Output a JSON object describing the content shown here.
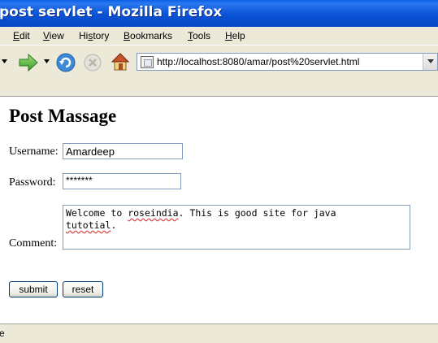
{
  "window": {
    "title": "post servlet - Mozilla Firefox"
  },
  "menu": {
    "items": [
      {
        "label": "Edit",
        "accel": "E"
      },
      {
        "label": "View",
        "accel": "V"
      },
      {
        "label": "History",
        "accel": "s"
      },
      {
        "label": "Bookmarks",
        "accel": "B"
      },
      {
        "label": "Tools",
        "accel": "T"
      },
      {
        "label": "Help",
        "accel": "H"
      }
    ]
  },
  "toolbar": {
    "url": "http://localhost:8080/amar/post%20servlet.html",
    "icons": [
      "back-dropdown-icon",
      "forward-icon",
      "forward-dropdown-icon",
      "reload-icon",
      "stop-icon",
      "home-icon",
      "page-icon",
      "url-dropdown-icon"
    ]
  },
  "page": {
    "title": "Post Massage",
    "username_label": "Username:",
    "username_value": "Amardeep",
    "password_label": "Password:",
    "password_mask": "*******",
    "comment_label": "Comment:",
    "comment_words": [
      "Welcome",
      "to",
      "roseindia.",
      "This",
      "is",
      "good",
      "site",
      "for",
      "java",
      "tutotial."
    ],
    "comment_misspelled": [
      "roseindia",
      "tutotial"
    ],
    "submit_label": "submit",
    "reset_label": "reset"
  },
  "status": {
    "text": "e"
  },
  "colors": {
    "titlebar": "#0a52d6",
    "chrome": "#ece9d8",
    "field_border": "#7f9db9",
    "button_border": "#003c74",
    "spellcheck": "#e04040"
  }
}
